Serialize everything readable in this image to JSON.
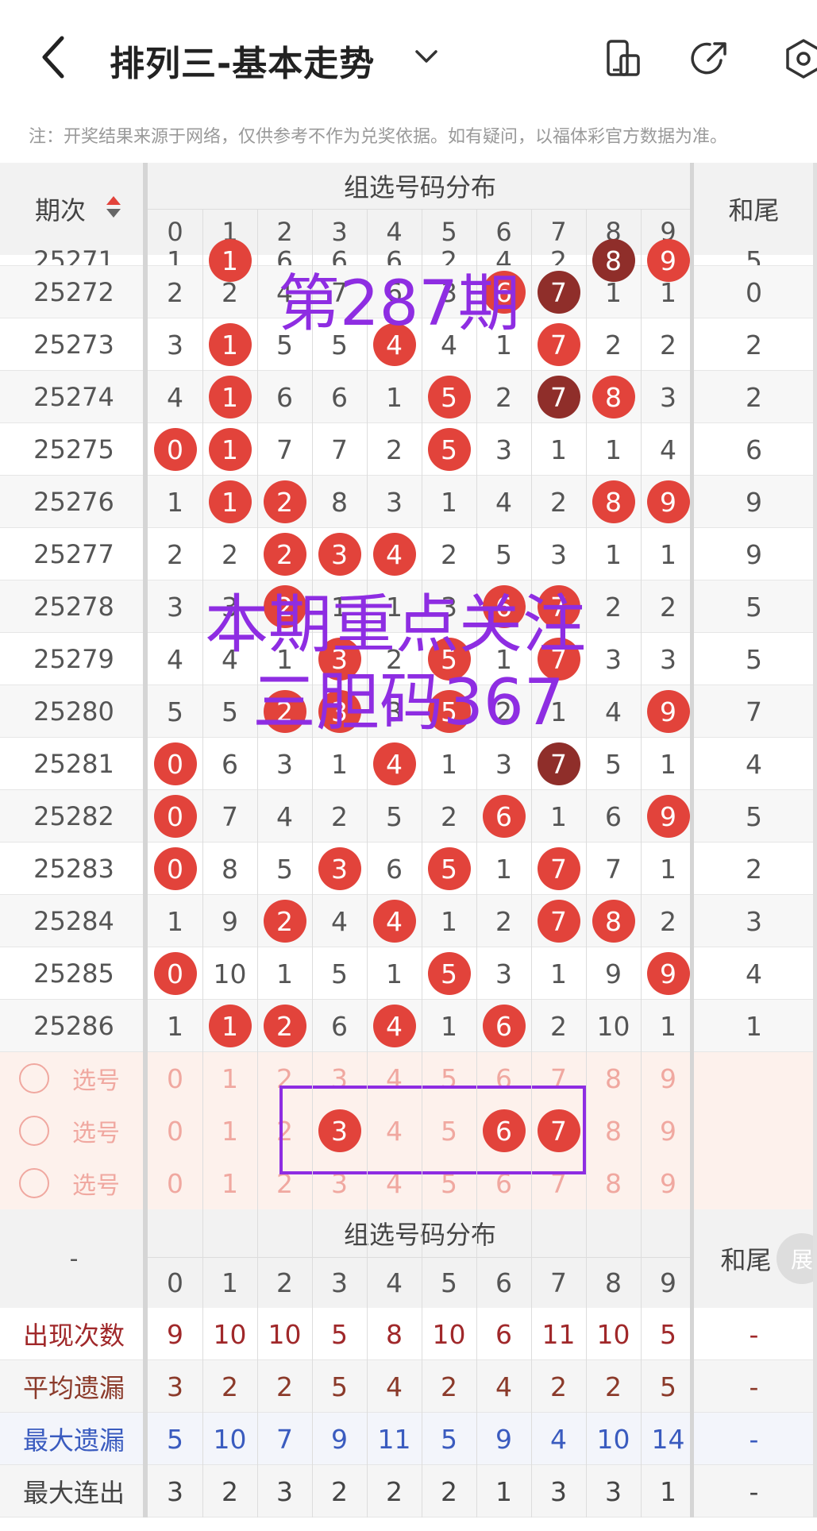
{
  "header": {
    "title": "排列三-基本走势",
    "notice": "注：开奖结果来源于网络，仅供参考不作为兑奖依据。如有疑问，以福体彩官方数据为准。"
  },
  "table": {
    "col_period": "期次",
    "group_header": "组选号码分布",
    "col_sum": "和尾",
    "digits": [
      "0",
      "1",
      "2",
      "3",
      "4",
      "5",
      "6",
      "7",
      "8",
      "9"
    ],
    "partial_row": {
      "period": "25271",
      "cells": [
        "1",
        "1",
        "6",
        "6",
        "6",
        "2",
        "4",
        "2",
        "8",
        "9"
      ],
      "sum": "5"
    },
    "rows": [
      {
        "period": "25272",
        "cells": [
          "2",
          "2",
          "4",
          "7",
          "6",
          "3",
          "6",
          "7",
          "1",
          "1"
        ],
        "sum": "0"
      },
      {
        "period": "25273",
        "cells": [
          "3",
          "1",
          "5",
          "5",
          "4",
          "4",
          "1",
          "7",
          "2",
          "2"
        ],
        "sum": "2"
      },
      {
        "period": "25274",
        "cells": [
          "4",
          "1",
          "6",
          "6",
          "1",
          "5",
          "2",
          "7",
          "8",
          "3"
        ],
        "sum": "2"
      },
      {
        "period": "25275",
        "cells": [
          "0",
          "1",
          "7",
          "7",
          "2",
          "5",
          "3",
          "1",
          "1",
          "4"
        ],
        "sum": "6"
      },
      {
        "period": "25276",
        "cells": [
          "1",
          "1",
          "2",
          "8",
          "3",
          "1",
          "4",
          "2",
          "8",
          "9"
        ],
        "sum": "9"
      },
      {
        "period": "25277",
        "cells": [
          "2",
          "2",
          "2",
          "3",
          "4",
          "2",
          "5",
          "3",
          "1",
          "1"
        ],
        "sum": "9"
      },
      {
        "period": "25278",
        "cells": [
          "3",
          "3",
          "2",
          "1",
          "1",
          "3",
          "6",
          "7",
          "2",
          "2"
        ],
        "sum": "5"
      },
      {
        "period": "25279",
        "cells": [
          "4",
          "4",
          "1",
          "3",
          "2",
          "5",
          "1",
          "7",
          "3",
          "3"
        ],
        "sum": "5"
      },
      {
        "period": "25280",
        "cells": [
          "5",
          "5",
          "2",
          "3",
          "3",
          "5",
          "2",
          "1",
          "4",
          "9"
        ],
        "sum": "7"
      },
      {
        "period": "25281",
        "cells": [
          "0",
          "6",
          "3",
          "1",
          "4",
          "1",
          "3",
          "7",
          "5",
          "1"
        ],
        "sum": "4"
      },
      {
        "period": "25282",
        "cells": [
          "0",
          "7",
          "4",
          "2",
          "5",
          "2",
          "6",
          "1",
          "6",
          "9"
        ],
        "sum": "5"
      },
      {
        "period": "25283",
        "cells": [
          "0",
          "8",
          "5",
          "3",
          "6",
          "5",
          "1",
          "7",
          "7",
          "1"
        ],
        "sum": "2"
      },
      {
        "period": "25284",
        "cells": [
          "1",
          "9",
          "2",
          "4",
          "4",
          "1",
          "2",
          "7",
          "8",
          "2"
        ],
        "sum": "3"
      },
      {
        "period": "25285",
        "cells": [
          "0",
          "10",
          "1",
          "5",
          "1",
          "5",
          "3",
          "1",
          "9",
          "9"
        ],
        "sum": "4"
      },
      {
        "period": "25286",
        "cells": [
          "1",
          "1",
          "2",
          "6",
          "4",
          "1",
          "6",
          "2",
          "10",
          "1"
        ],
        "sum": "1"
      }
    ]
  },
  "select_rows": {
    "label": "选号",
    "digits": [
      "0",
      "1",
      "2",
      "3",
      "4",
      "5",
      "6",
      "7",
      "8",
      "9"
    ]
  },
  "stats": {
    "dash": "-",
    "group_header": "组选号码分布",
    "col_sum": "和尾",
    "expand": "展",
    "digits": [
      "0",
      "1",
      "2",
      "3",
      "4",
      "5",
      "6",
      "7",
      "8",
      "9"
    ],
    "rows": [
      {
        "label": "出现次数",
        "values": [
          "9",
          "10",
          "10",
          "5",
          "8",
          "10",
          "6",
          "11",
          "10",
          "5"
        ],
        "sum": "-",
        "color": "#a0282a"
      },
      {
        "label": "平均遗漏",
        "values": [
          "3",
          "2",
          "2",
          "5",
          "4",
          "2",
          "4",
          "2",
          "2",
          "5"
        ],
        "sum": "-",
        "color": "#8b3a2a"
      },
      {
        "label": "最大遗漏",
        "values": [
          "5",
          "10",
          "7",
          "9",
          "11",
          "5",
          "9",
          "4",
          "10",
          "14"
        ],
        "sum": "-",
        "color": "#3a5bbf"
      },
      {
        "label": "最大连出",
        "values": [
          "3",
          "2",
          "3",
          "2",
          "2",
          "2",
          "1",
          "3",
          "3",
          "1"
        ],
        "sum": "-",
        "color": "#444"
      }
    ]
  },
  "overlay": {
    "line1": "第287期",
    "line2": "本期重点关注",
    "line3": "三胆码367"
  },
  "colors": {
    "ball_red": "#e2433b",
    "ball_dark": "#8f2e2a",
    "overlay": "#8e2de2"
  }
}
